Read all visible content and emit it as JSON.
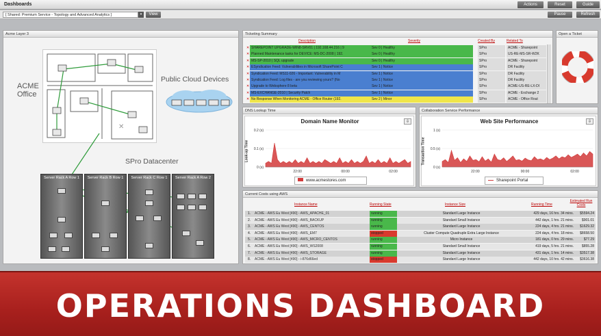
{
  "app": {
    "title": "Dashboards",
    "buttons": [
      "Actions",
      "Reset",
      "Guide"
    ],
    "sub_buttons": [
      "Pause",
      "Refresh"
    ],
    "dashboard_select": "[ Shared: Premium Service - Topology and Advanced Analytics ]",
    "go_label": "View"
  },
  "left_panel": {
    "title": "Acme Layer 3",
    "office_label": "ACME\nOffice",
    "cloud_label": "Public Cloud Devices",
    "datacenter_label": "SPro Datacenter",
    "racks": [
      "Server Rack A Row 1",
      "Server Rack B Row 1",
      "Server Rack C Row 1",
      "Server Rack A Row 2"
    ]
  },
  "ticketing": {
    "title": "Ticketing Summary",
    "headers": [
      "Description",
      "Severity",
      "Created By",
      "Related To"
    ],
    "rows": [
      {
        "desc": "SHAREPOINT UPGRADE-WIN8-SRV01 | 192.168.44.216 | 9",
        "sev": "Sev 0 | Healthy",
        "by": "SPro",
        "rel": "ACME - Sharepoint",
        "color": "#49b84a"
      },
      {
        "desc": "Planned Maintenance tasks for DEVICE: MS-DC-2008 | 192.",
        "sev": "Sev 0 | Healthy",
        "by": "SPro",
        "rel": "US-RE-MS-SR-W2K",
        "color": "#49b84a"
      },
      {
        "desc": "MS-SP-2010 | SQL upgrade",
        "sev": "Sev 0 | Healthy",
        "by": "SPro",
        "rel": "ACME - Sharepoint",
        "color": "#49b84a"
      },
      {
        "desc": "ESyndication Feed: Vulnerabilities in Microsoft SharePoint C",
        "sev": "Sev 1 | Notice",
        "by": "SPro",
        "rel": "DR Facility",
        "color": "#4a7fd0"
      },
      {
        "desc": "Syndication Feed: MS11-026 - Important: Vulnerability in M",
        "sev": "Sev 1 | Notice",
        "by": "SPro",
        "rel": "DR Facility",
        "color": "#4a7fd0"
      },
      {
        "desc": "Syndication Feed: Log files - are you reviewing yours? (No",
        "sev": "Sev 1 | Notice",
        "by": "SPro",
        "rel": "DR Facility",
        "color": "#4a7fd0"
      },
      {
        "desc": "Upgrade to Websphere 8 beta",
        "sev": "Sev 1 | Notice",
        "by": "SPro",
        "rel": "ACME-US-RE-LX-DI",
        "color": "#4a7fd0"
      },
      {
        "desc": "MS-EXCHANGE-2010 | Security Patch",
        "sev": "Sev 1 | Notice",
        "by": "SPro",
        "rel": "ACME - Exchange 2",
        "color": "#4a7fd0"
      },
      {
        "desc": "No Response When Monitoring ACME - Office Router (192.",
        "sev": "Sev 2 | Minor",
        "by": "SPro",
        "rel": "ACME - Office Rout",
        "color": "#f0e64a"
      }
    ]
  },
  "open_ticket": {
    "title": "Open a Ticket"
  },
  "dns": {
    "title": "DNS Lookup Time",
    "chart_title": "Domain Name Monitor",
    "ylabel": "Look-up Time",
    "legend": "www.acmestores.com"
  },
  "collab": {
    "title": "Collaboration Service Performance",
    "chart_title": "Web Site Performance",
    "ylabel": "Transaction Time",
    "legend": "Sharepoint Portal"
  },
  "chart_data": [
    {
      "type": "area",
      "title": "Domain Name Monitor",
      "ylabel": "Look-up Time",
      "x_ticks": [
        "22:00",
        "00:00",
        "02:00"
      ],
      "y_ticks": [
        "0 (s)",
        "0.1 (s)",
        "0.2 (s)"
      ],
      "ylim": [
        0,
        0.2
      ],
      "series": [
        {
          "name": "www.acmestores.com",
          "color": "#d23a3a",
          "values": [
            0.02,
            0.03,
            0.02,
            0.13,
            0.04,
            0.02,
            0.03,
            0.02,
            0.03,
            0.02,
            0.04,
            0.02,
            0.03,
            0.02,
            0.05,
            0.02,
            0.03,
            0.02,
            0.03,
            0.02,
            0.04,
            0.03,
            0.02,
            0.03,
            0.02,
            0.05,
            0.02,
            0.03,
            0.02,
            0.04,
            0.02,
            0.03,
            0.02,
            0.03,
            0.06,
            0.02,
            0.03,
            0.02,
            0.04,
            0.02,
            0.03,
            0.02,
            0.05,
            0.02,
            0.03,
            0.02,
            0.03,
            0.04,
            0.02,
            0.03
          ]
        }
      ]
    },
    {
      "type": "area",
      "title": "Web Site Performance",
      "ylabel": "Transaction Time",
      "x_ticks": [
        "22:00",
        "00:00",
        "02:00"
      ],
      "y_ticks": [
        "0 (s)",
        "0.5 (s)",
        "1 (s)"
      ],
      "ylim": [
        0,
        1
      ],
      "series": [
        {
          "name": "Sharepoint Portal",
          "color": "#d23a3a",
          "values": [
            0.15,
            0.2,
            0.12,
            0.45,
            0.18,
            0.25,
            0.12,
            0.22,
            0.15,
            0.3,
            0.18,
            0.2,
            0.14,
            0.28,
            0.16,
            0.22,
            0.13,
            0.35,
            0.2,
            0.18,
            0.25,
            0.15,
            0.22,
            0.3,
            0.18,
            0.2,
            0.16,
            0.24,
            0.19,
            0.17,
            0.28,
            0.2,
            0.22,
            0.18,
            0.26,
            0.2,
            0.24,
            0.3,
            0.22,
            0.28,
            0.25,
            0.33,
            0.26,
            0.3,
            0.35,
            0.28,
            0.38,
            0.3,
            0.42,
            0.35
          ]
        }
      ]
    }
  ],
  "costs": {
    "title": "Current Costs using AWS",
    "headers": [
      "Instance Name",
      "Running State",
      "Instance Size",
      "Running Time",
      "Estimated Run Costs"
    ],
    "rows": [
      {
        "n": "1.",
        "name": "ACME - AWS Eu West [490] - AWS_APACHE_01",
        "state": "running",
        "size": "Standard Large Instance",
        "time": "429 days, 16 hrs. 34 mins.",
        "cost": "$5594.24"
      },
      {
        "n": "2.",
        "name": "ACME - AWS Eu West [490] - AWS_BACKUP",
        "state": "running",
        "size": "Standard Small Instance",
        "time": "442 days, 1 hrs. 21 mins.",
        "cost": "$901.01"
      },
      {
        "n": "3.",
        "name": "ACME - AWS Eu West [490] - AWS_CENTOS",
        "state": "running",
        "size": "Standard Large Instance",
        "time": "224 days, 4 hrs. 21 mins.",
        "cost": "$1629.32"
      },
      {
        "n": "4.",
        "name": "ACME - AWS Eu West [490] - AWS_EM7",
        "state": "stopped",
        "size": "Cluster Compute Quadruple Extra Large Instance",
        "time": "224 days, 4 hrs. 18 mins.",
        "cost": "$8658.50"
      },
      {
        "n": "5.",
        "name": "ACME - AWS Eu West [490] - AWS_MICRO_CENTOS",
        "state": "running",
        "size": "Micro Instance",
        "time": "181 days, 0 hrs. 29 mins.",
        "cost": "$77.29"
      },
      {
        "n": "6.",
        "name": "ACME - AWS Eu West [490] - AWS_WS2008",
        "state": "running",
        "size": "Standard Small Instance",
        "time": "419 days, 5 hrs. 21 mins.",
        "cost": "$855.28"
      },
      {
        "n": "7.",
        "name": "ACME - AWS Eu West [490] - AWS_STORAGE",
        "state": "running",
        "size": "Standard Large Instance",
        "time": "431 days, 1 hrs. 14 mins.",
        "cost": "$3517.38"
      },
      {
        "n": "8.",
        "name": "ACME - AWS Eu West [490] - i-876d66ed",
        "state": "stopped",
        "size": "Standard Large Instance",
        "time": "442 days, 10 hrs. 42 mins.",
        "cost": "$3616.38"
      }
    ]
  },
  "banner": {
    "text": "OPERATIONS DASHBOARD"
  },
  "colors": {
    "running": "#49b84a",
    "stopped": "#d83a2e",
    "banner": "#b02622"
  }
}
